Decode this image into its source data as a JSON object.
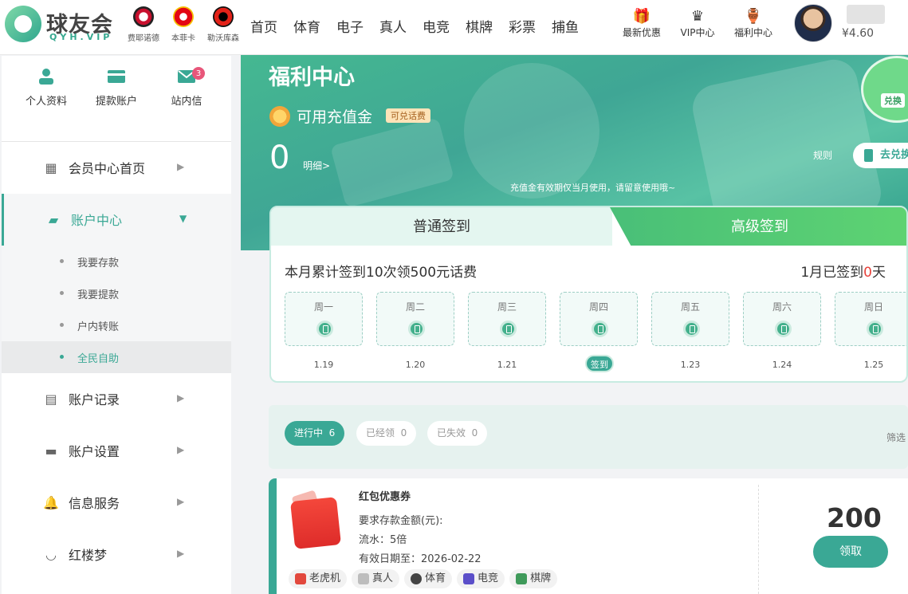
{
  "header": {
    "logo_name": "球友会",
    "logo_sub": "QYH.VIP",
    "teams": [
      {
        "name": "费耶诺德",
        "icon": "feyenoord-badge-icon"
      },
      {
        "name": "本菲卡",
        "icon": "benfica-badge-icon"
      },
      {
        "name": "勒沃库森",
        "icon": "leverkusen-badge-icon"
      }
    ],
    "nav": [
      "首页",
      "体育",
      "电子",
      "真人",
      "电竞",
      "棋牌",
      "彩票",
      "捕鱼"
    ],
    "icons": [
      {
        "label": "最新优惠",
        "icon": "gift-icon",
        "glyph": "🎁"
      },
      {
        "label": "VIP中心",
        "icon": "crown-icon",
        "glyph": "♛"
      },
      {
        "label": "福利中心",
        "icon": "jar-icon",
        "glyph": "🏺"
      }
    ],
    "balance": "¥4.60"
  },
  "sidebar": {
    "quick": [
      {
        "label": "个人资料",
        "icon": "user-icon"
      },
      {
        "label": "提款账户",
        "icon": "card-icon"
      },
      {
        "label": "站内信",
        "icon": "mail-icon",
        "badge": "3"
      }
    ],
    "menu": [
      {
        "label": "会员中心首页",
        "icon": "dashboard-icon",
        "glyph": "▦"
      },
      {
        "label": "账户中心",
        "icon": "wallet-icon",
        "glyph": "▰"
      },
      {
        "label": "账户记录",
        "icon": "list-icon",
        "glyph": "▤"
      },
      {
        "label": "账户设置",
        "icon": "folder-icon",
        "glyph": "▬"
      },
      {
        "label": "信息服务",
        "icon": "bell-icon",
        "glyph": "🔔"
      },
      {
        "label": "红楼梦",
        "icon": "lips-icon",
        "glyph": "◡"
      }
    ],
    "sub": [
      "我要存款",
      "我要提款",
      "户内转账",
      "全民自助"
    ]
  },
  "banner": {
    "title": "福利中心",
    "subtitle": "可用充值金",
    "tag": "可兑话费",
    "amount": "0",
    "detail": "明细>",
    "rule": "规则",
    "go": "去兑换",
    "note": "充值金有效期仅当月使用，请留意使用哦~",
    "swap": "兑换"
  },
  "sign": {
    "tab_normal": "普通签到",
    "tab_premium": "高级签到",
    "title": "本月累计签到10次领500元话费",
    "count_prefix": "1月已签到",
    "count_value": "0",
    "count_suffix": "天",
    "days": [
      {
        "label": "周一",
        "date": "1.19"
      },
      {
        "label": "周二",
        "date": "1.20"
      },
      {
        "label": "周三",
        "date": "1.21"
      },
      {
        "label": "周四",
        "date": "",
        "button": "签到"
      },
      {
        "label": "周五",
        "date": "1.23"
      },
      {
        "label": "周六",
        "date": "1.24"
      },
      {
        "label": "周日",
        "date": "1.25"
      }
    ]
  },
  "filter": {
    "pills": [
      {
        "label": "进行中",
        "count": "6"
      },
      {
        "label": "已经领",
        "count": "0"
      },
      {
        "label": "已失效",
        "count": "0"
      }
    ],
    "right": "筛选"
  },
  "coupon": {
    "name": "红包优惠券",
    "req": "要求存款金额(元):",
    "flow": "流水：5倍",
    "expire": "有效日期至：2026-02-22",
    "value": "200",
    "btn": "领取",
    "games": [
      {
        "label": "老虎机",
        "icon": "slot-icon",
        "color": "#e2483d"
      },
      {
        "label": "真人",
        "icon": "dice-icon",
        "color": "#bdbdbd"
      },
      {
        "label": "体育",
        "icon": "soccer-icon",
        "color": "#444444"
      },
      {
        "label": "电竞",
        "icon": "gamepad-icon",
        "color": "#5b4fc9"
      },
      {
        "label": "棋牌",
        "icon": "mahjong-icon",
        "color": "#3f9a5a"
      }
    ]
  }
}
